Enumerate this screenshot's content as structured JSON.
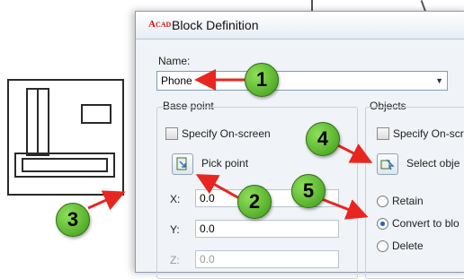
{
  "dialog": {
    "title": "Block Definition",
    "name_label": "Name:",
    "name_value": "Phone",
    "base_point": {
      "group_label": "Base point",
      "specify_onscreen_label": "Specify On-screen",
      "pick_point_label": "Pick point",
      "x_label": "X:",
      "x_value": "0.0",
      "y_label": "Y:",
      "y_value": "0.0",
      "z_label": "Z:",
      "z_value": "0.0"
    },
    "objects": {
      "group_label": "Objects",
      "specify_onscreen_label": "Specify On-scr",
      "select_objects_label": "Select obje",
      "options": [
        {
          "label": "Retain",
          "selected": false
        },
        {
          "label": "Convert to blo",
          "selected": true
        },
        {
          "label": "Delete",
          "selected": false
        }
      ]
    }
  },
  "callouts": {
    "one": "1",
    "two": "2",
    "three": "3",
    "four": "4",
    "five": "5",
    "badge_color": "#5cbf2a",
    "arrow_color": "#e8261f"
  },
  "icons": {
    "app": "autocad-icon",
    "pick_point": "pick-point-icon",
    "select_objects": "select-objects-icon"
  }
}
